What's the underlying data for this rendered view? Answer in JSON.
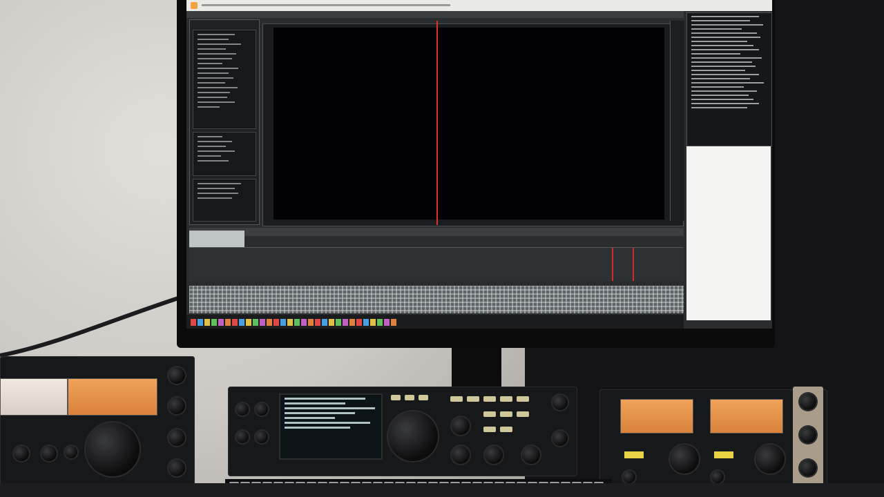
{
  "scene": {
    "description_items": [
      "monitor",
      "audio-editor",
      "radio-transceivers"
    ]
  },
  "colors": {
    "waveform": "#1ec8ff",
    "playhead": "#e0302f",
    "meter_orange": "#f0a35a",
    "meter_cream": "#f1e9df"
  },
  "icons": [
    "knob-icon",
    "meter-icon",
    "app-icon"
  ]
}
